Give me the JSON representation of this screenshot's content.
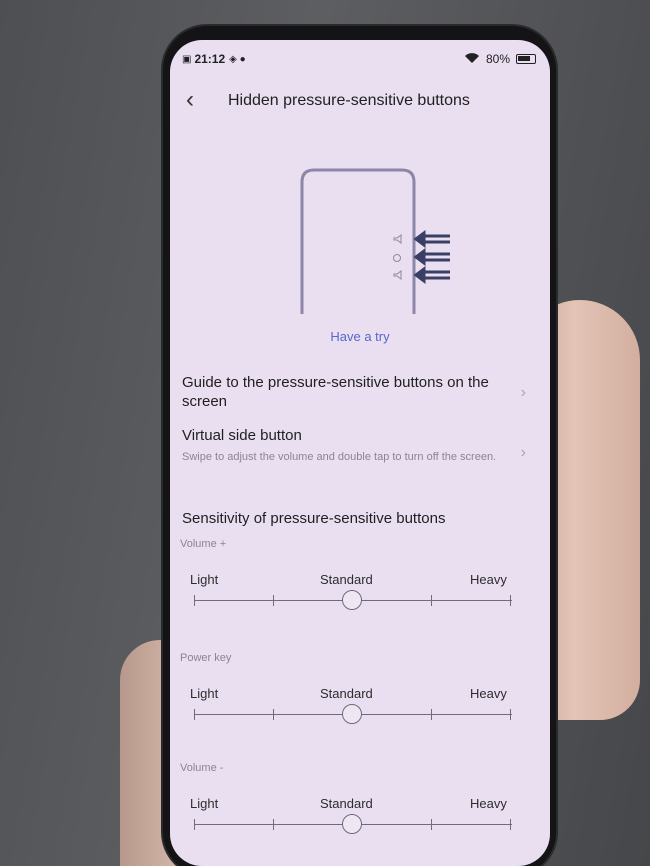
{
  "status_bar": {
    "time": "21:12",
    "battery_percent": "80%",
    "wifi_icon": "wifi-icon",
    "battery_icon": "battery-icon"
  },
  "header": {
    "back_icon": "back-arrow-icon",
    "title": "Hidden pressure-sensitive buttons"
  },
  "illustration": {
    "icon": "phone-side-buttons-illustration",
    "arrow_color": "#3a3f66"
  },
  "have_try": "Have a try",
  "settings": [
    {
      "title": "Guide to the pressure-sensitive buttons on the screen",
      "subtitle": ""
    },
    {
      "title": "Virtual side button",
      "subtitle": "Swipe to adjust the volume and double tap to turn off the screen."
    }
  ],
  "sensitivity": {
    "title": "Sensitivity of pressure-sensitive buttons",
    "sliders": [
      {
        "label": "Volume +",
        "light": "Light",
        "standard": "Standard",
        "heavy": "Heavy",
        "level": "Standard",
        "value_fraction": 0.5
      },
      {
        "label": "Power key",
        "light": "Light",
        "standard": "Standard",
        "heavy": "Heavy",
        "level": "Standard",
        "value_fraction": 0.5
      },
      {
        "label": "Volume -",
        "light": "Light",
        "standard": "Standard",
        "heavy": "Heavy",
        "level": "Standard",
        "value_fraction": 0.5
      }
    ]
  },
  "colors": {
    "screen_bg": "#e9dff0",
    "accent_link": "#5867c8",
    "text_primary": "#1f1f1f",
    "text_secondary": "#8a8590"
  }
}
